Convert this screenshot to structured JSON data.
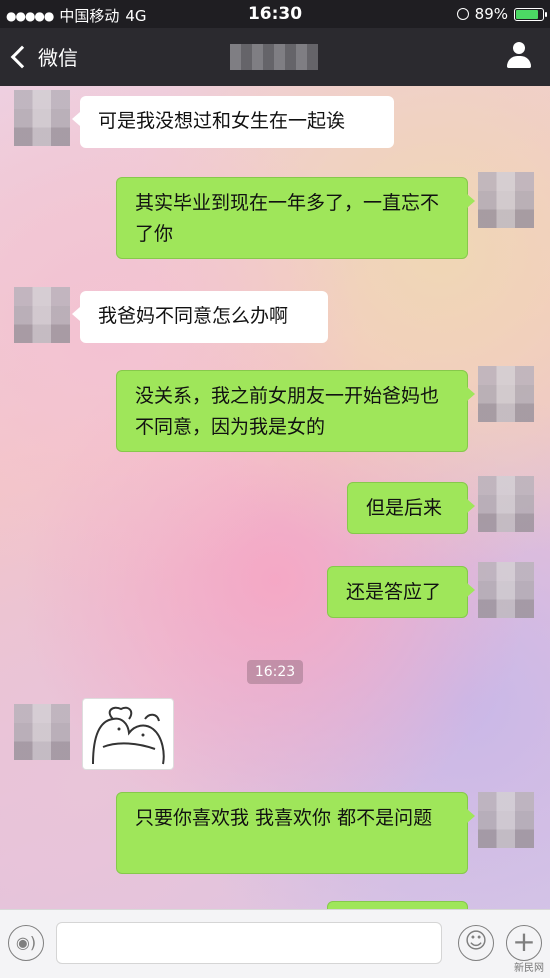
{
  "status_bar": {
    "signal_dots": "●●●●●",
    "carrier": "中国移动",
    "network": "4G",
    "time": "16:30",
    "battery_percent": "89%",
    "battery_level": 0.89
  },
  "nav": {
    "back_label": "微信",
    "icons": {
      "back": "chevron-left-icon",
      "profile": "person-icon"
    }
  },
  "messages": [
    {
      "side": "in",
      "text": "可是我没想过和女生在一起诶"
    },
    {
      "side": "out",
      "text": "其实毕业到现在一年多了，一直忘不了你"
    },
    {
      "side": "in",
      "text": "我爸妈不同意怎么办啊"
    },
    {
      "side": "out",
      "text": "没关系，我之前女朋友一开始爸妈也不同意，因为我是女的"
    },
    {
      "side": "out",
      "text": "但是后来"
    },
    {
      "side": "out",
      "text": "还是答应了"
    },
    {
      "type": "timestamp",
      "text": "16:23"
    },
    {
      "side": "in",
      "type": "sticker",
      "icon": "hug-sticker-icon"
    },
    {
      "side": "out",
      "text": "只要你喜欢我 我喜欢你 都不是问题"
    }
  ],
  "input_bar": {
    "icons": {
      "voice": "voice-icon",
      "emoji": "emoji-icon",
      "more": "plus-icon"
    },
    "voice_glyph": "◉)",
    "emoji_glyph": "☺",
    "plus_glyph": "+"
  },
  "watermark": "新民网"
}
